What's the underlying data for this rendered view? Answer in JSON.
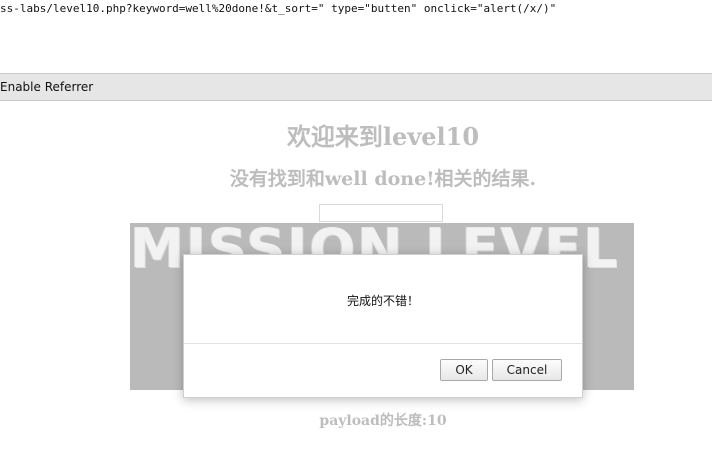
{
  "address_bar": {
    "url_text": "ss-labs/level10.php?keyword=well%20done!&t_sort=\" type=\"butten\" onclick=\"alert(/x/)\""
  },
  "toolbar": {
    "enable_referrer_label": "Enable Referrer"
  },
  "page": {
    "title": "欢迎来到level10",
    "result_text": "没有找到和well done!相关的结果.",
    "search_value": "",
    "banner_text": "MISSION LEVEL 10",
    "payload_length": "payload的长度:10"
  },
  "dialog": {
    "message": "完成的不错！",
    "ok_label": "OK",
    "cancel_label": "Cancel"
  }
}
